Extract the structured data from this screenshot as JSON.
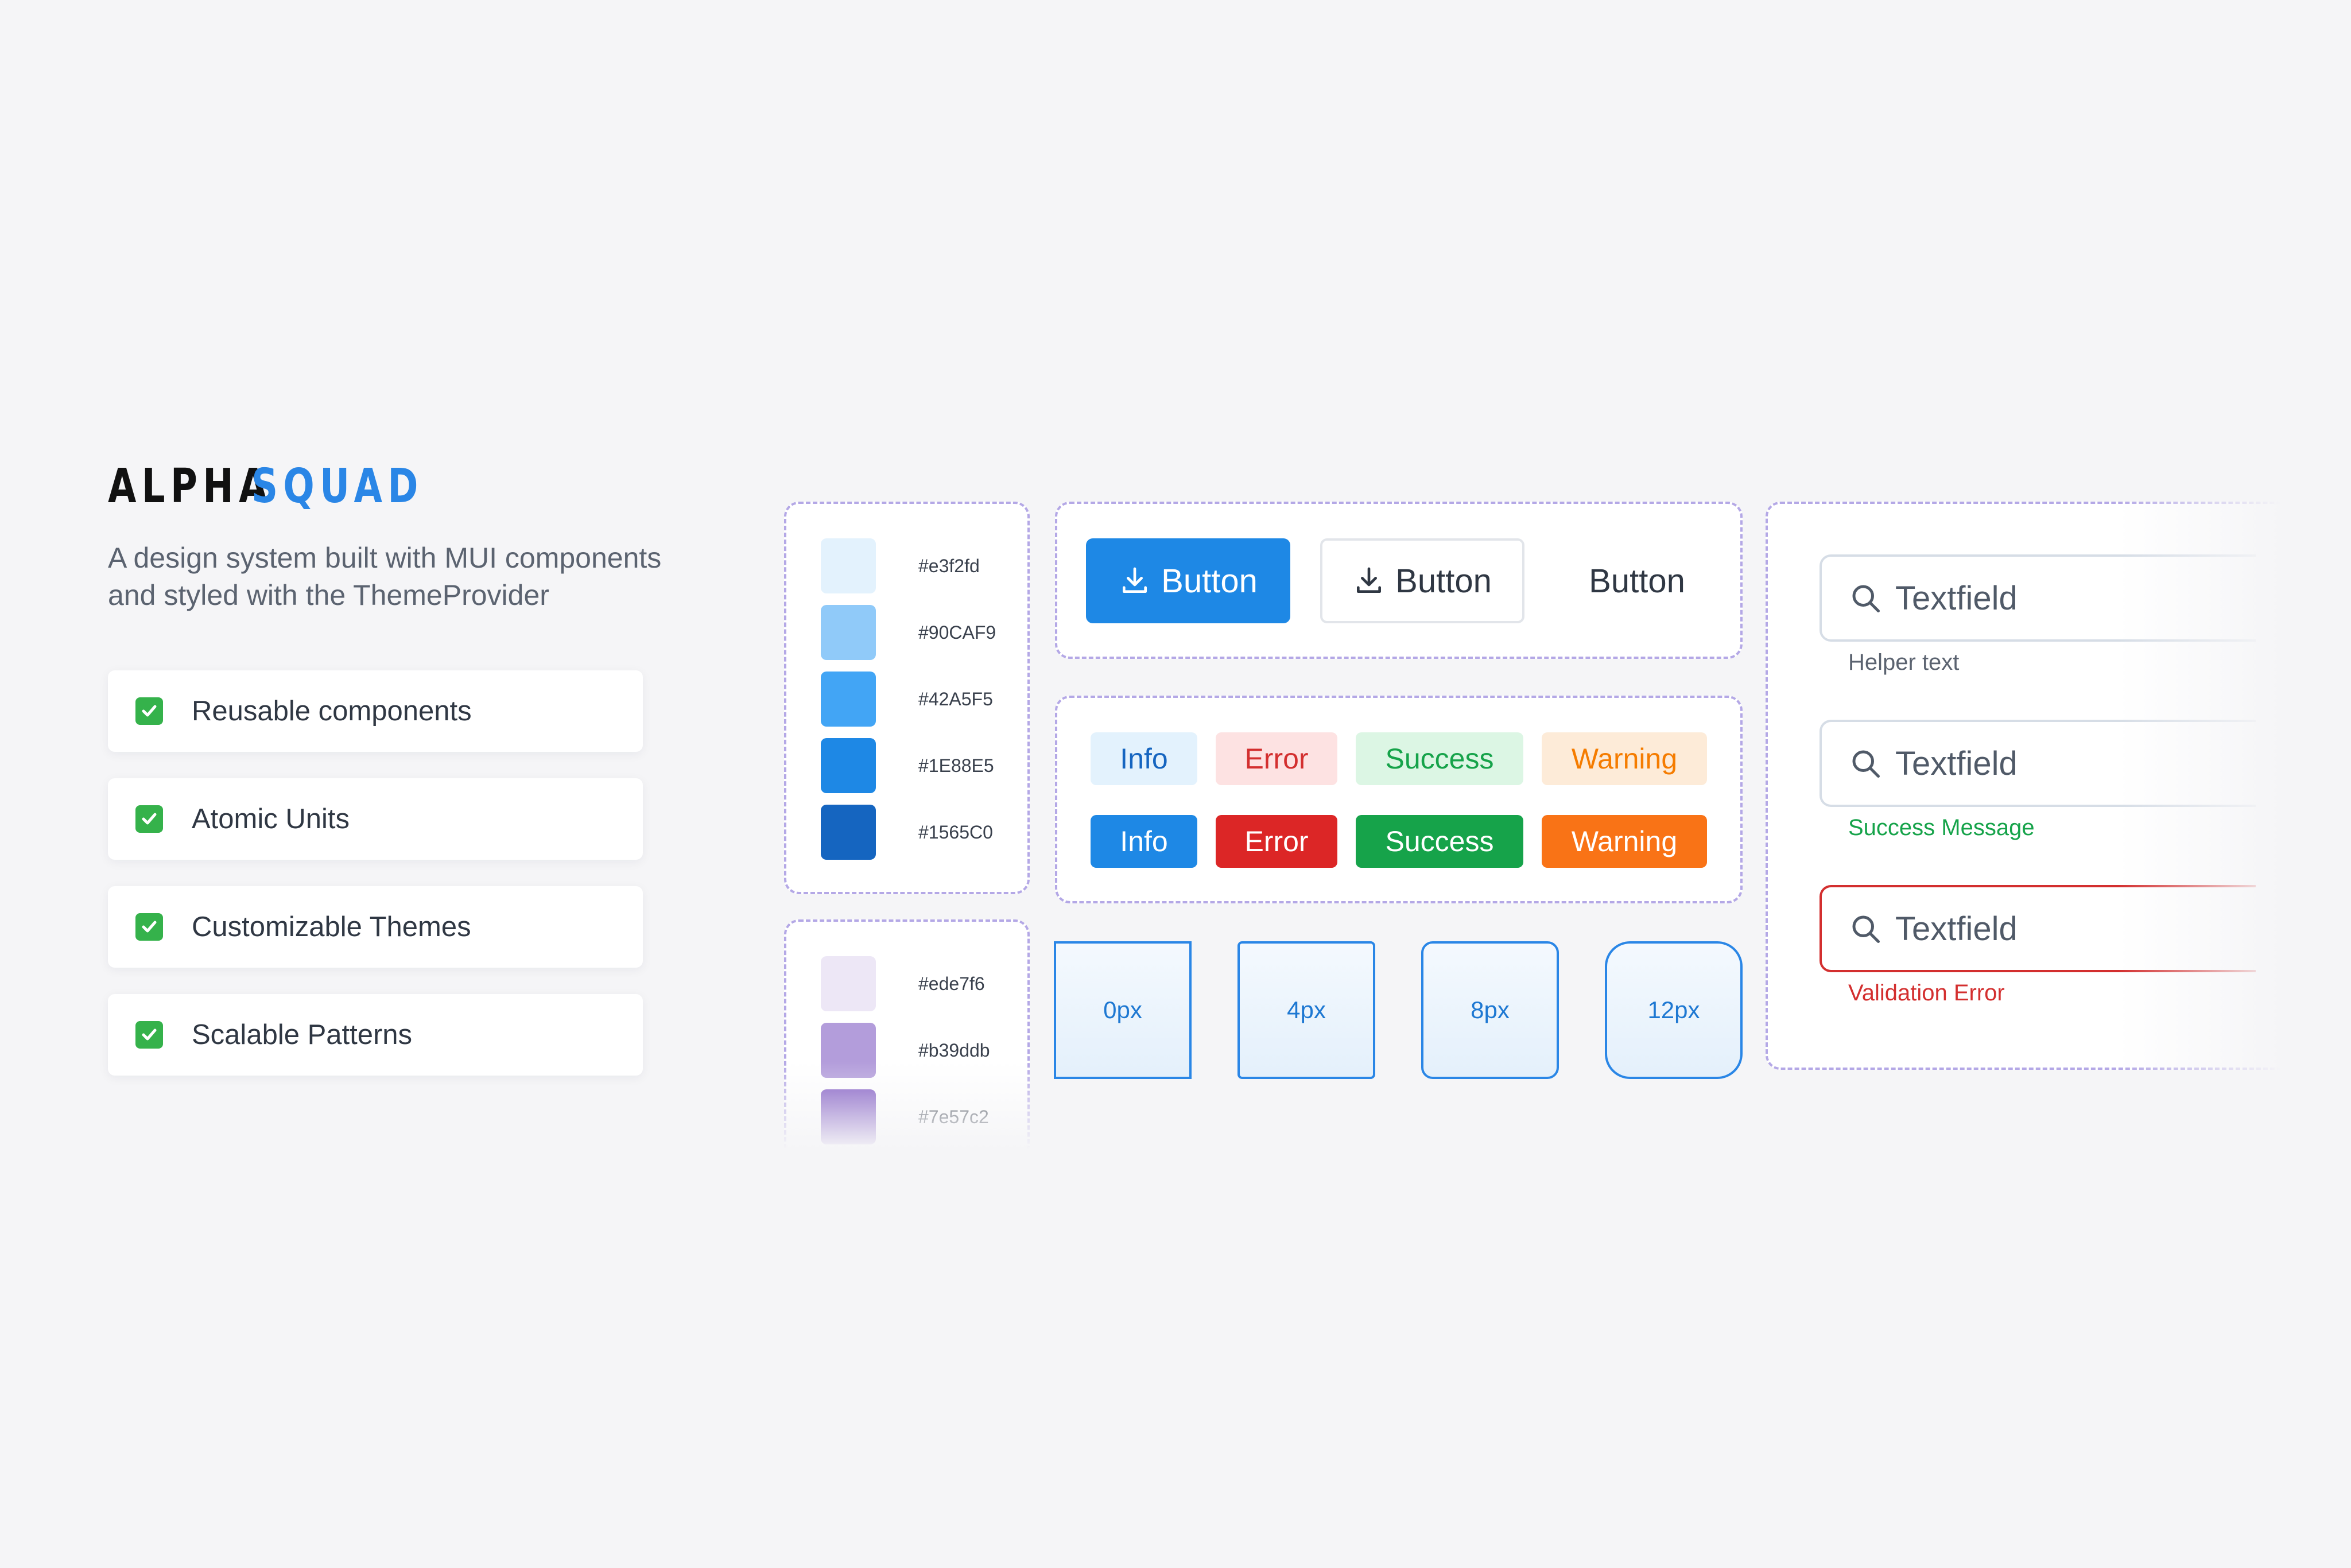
{
  "brand": {
    "part1": "ALPHA",
    "part2": "SQUAD",
    "accent": "#2a86e6"
  },
  "tagline": {
    "line1": "A design system built with MUI components",
    "line2": "and styled with the ThemeProvider"
  },
  "features": [
    {
      "label": "Reusable components",
      "icon": "check-box-icon"
    },
    {
      "label": "Atomic Units",
      "icon": "check-box-icon"
    },
    {
      "label": "Customizable Themes",
      "icon": "check-box-icon"
    },
    {
      "label": "Scalable Patterns",
      "icon": "check-box-icon"
    }
  ],
  "palette_blue": [
    {
      "code": "#e3f2fd",
      "color": "#e3f2fd"
    },
    {
      "code": "#90CAF9",
      "color": "#90CAF9"
    },
    {
      "code": "#42A5F5",
      "color": "#42A5F5"
    },
    {
      "code": "#1E88E5",
      "color": "#1E88E5"
    },
    {
      "code": "#1565C0",
      "color": "#1565C0"
    }
  ],
  "palette_purple": [
    {
      "code": "#ede7f6",
      "color": "#ede7f6"
    },
    {
      "code": "#b39ddb",
      "color": "#b39ddb"
    },
    {
      "code": "#7e57c2",
      "color": "#7e57c2"
    }
  ],
  "buttons": {
    "contained": {
      "label": "Button",
      "icon": "download-icon"
    },
    "outlined": {
      "label": "Button",
      "icon": "download-icon"
    },
    "text": {
      "label": "Button"
    }
  },
  "chips_light": [
    {
      "label": "Info",
      "bg": "#e3f2fd",
      "color": "#1565c0"
    },
    {
      "label": "Error",
      "bg": "#fde2e2",
      "color": "#d32f2f"
    },
    {
      "label": "Success",
      "bg": "#dcf6e4",
      "color": "#16a34a"
    },
    {
      "label": "Warning",
      "bg": "#fdebd8",
      "color": "#f57c00"
    }
  ],
  "chips_solid": [
    {
      "label": "Info",
      "bg": "#1e88e5",
      "color": "#ffffff"
    },
    {
      "label": "Error",
      "bg": "#dc2626",
      "color": "#ffffff"
    },
    {
      "label": "Success",
      "bg": "#16a34a",
      "color": "#ffffff"
    },
    {
      "label": "Warning",
      "bg": "#f97316",
      "color": "#ffffff"
    }
  ],
  "radii": [
    {
      "label": "0px"
    },
    {
      "label": "4px"
    },
    {
      "label": "8px"
    },
    {
      "label": "12px"
    }
  ],
  "textfields": [
    {
      "placeholder": "Textfield",
      "helper": "Helper text",
      "helper_color": "#5b6370",
      "state": "default",
      "icon": "search-icon"
    },
    {
      "placeholder": "Textfield",
      "helper": "Success Message",
      "helper_color": "#16a34a",
      "state": "success",
      "icon": "search-icon"
    },
    {
      "placeholder": "Textfield",
      "helper": "Validation Error",
      "helper_color": "#d32f2f",
      "state": "error",
      "icon": "search-icon"
    }
  ]
}
